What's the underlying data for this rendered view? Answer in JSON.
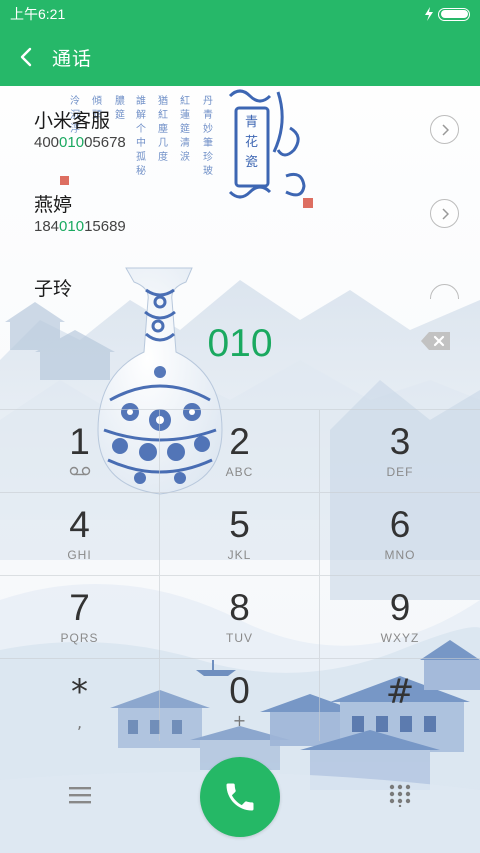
{
  "status_bar": {
    "time": "上午6:21",
    "charging_icon": "bolt-icon",
    "battery_level": 1.0
  },
  "header": {
    "back_icon": "chevron-left-icon",
    "title": "通话"
  },
  "contacts": [
    {
      "name": "小米客服",
      "number_prefix": "400",
      "number_match": "010",
      "number_suffix": "05678"
    },
    {
      "name": "燕婷",
      "number_prefix": "184",
      "number_match": "010",
      "number_suffix": "15689"
    },
    {
      "name": "子玲"
    }
  ],
  "dial": {
    "number": "010",
    "backspace_icon": "backspace-icon"
  },
  "keypad": [
    {
      "digit": "1",
      "letters": "",
      "icon": "voicemail-icon"
    },
    {
      "digit": "2",
      "letters": "ABC"
    },
    {
      "digit": "3",
      "letters": "DEF"
    },
    {
      "digit": "4",
      "letters": "GHI"
    },
    {
      "digit": "5",
      "letters": "JKL"
    },
    {
      "digit": "6",
      "letters": "MNO"
    },
    {
      "digit": "7",
      "letters": "PQRS"
    },
    {
      "digit": "8",
      "letters": "TUV"
    },
    {
      "digit": "9",
      "letters": "WXYZ"
    },
    {
      "digit": "*",
      "letters": ","
    },
    {
      "digit": "0",
      "letters": "+"
    },
    {
      "digit": "#",
      "letters": ""
    }
  ],
  "bottom_bar": {
    "menu_icon": "menu-icon",
    "call_icon": "phone-icon",
    "dialpad_icon": "dialpad-icon"
  },
  "colors": {
    "accent": "#26b869",
    "highlight": "#1aa960"
  }
}
